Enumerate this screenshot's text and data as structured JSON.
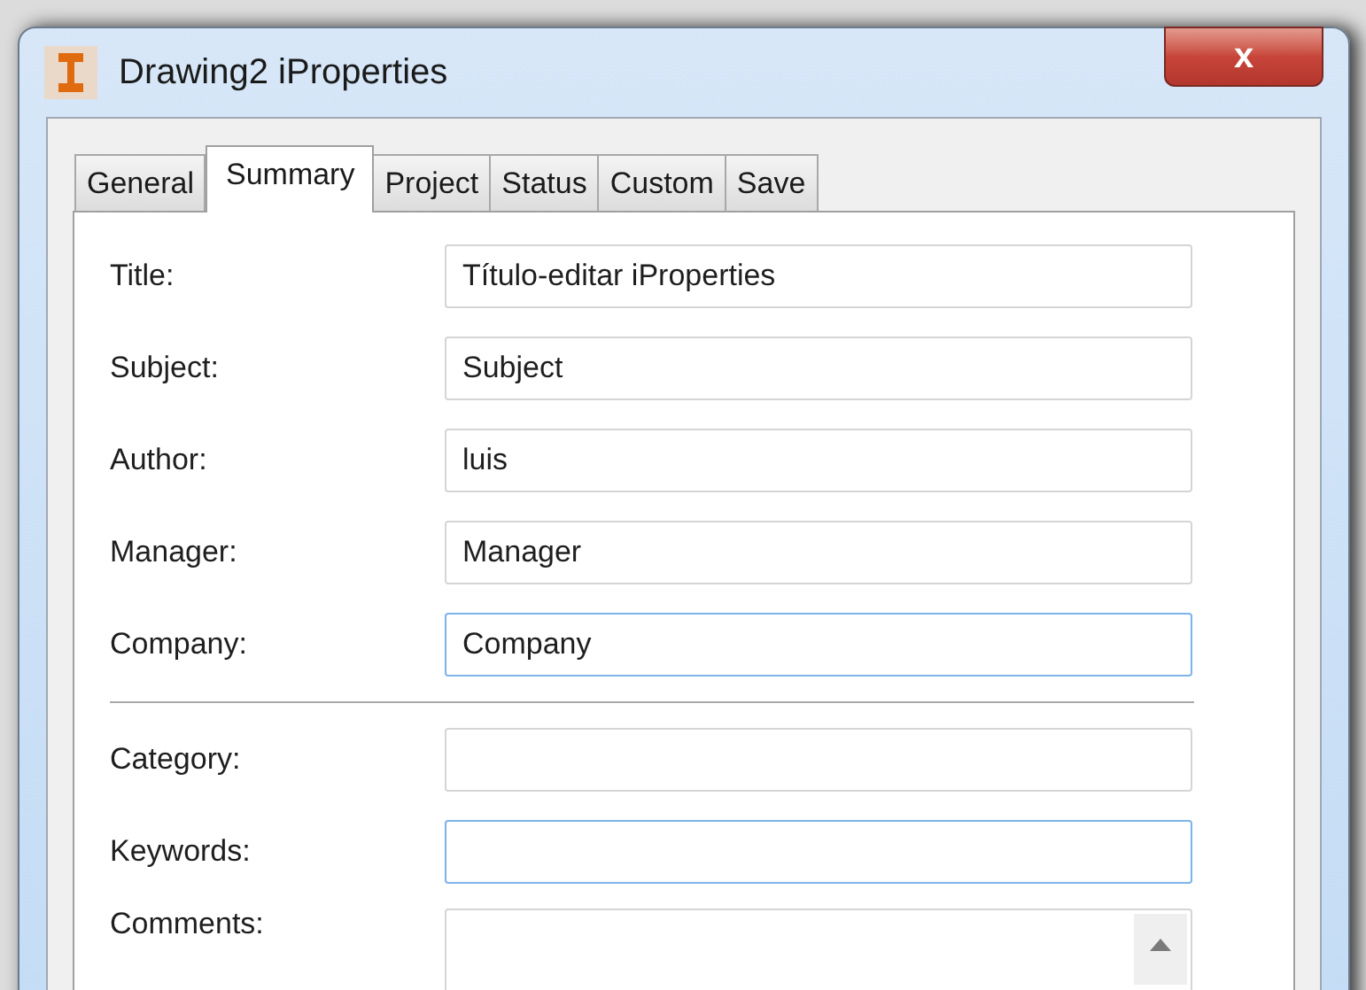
{
  "window": {
    "title": "Drawing2 iProperties",
    "close_label": "x"
  },
  "tabs": [
    {
      "label": "General",
      "selected": false
    },
    {
      "label": "Summary",
      "selected": true
    },
    {
      "label": "Project",
      "selected": false
    },
    {
      "label": "Status",
      "selected": false
    },
    {
      "label": "Custom",
      "selected": false
    },
    {
      "label": "Save",
      "selected": false
    }
  ],
  "fields": [
    {
      "label": "Title:",
      "value": "Título-editar iProperties",
      "highlighted": false,
      "kind": "text"
    },
    {
      "label": "Subject:",
      "value": "Subject",
      "highlighted": false,
      "kind": "text"
    },
    {
      "label": "Author:",
      "value": "luis",
      "highlighted": false,
      "kind": "text"
    },
    {
      "label": "Manager:",
      "value": "Manager",
      "highlighted": false,
      "kind": "text"
    },
    {
      "label": "Company:",
      "value": "Company",
      "highlighted": true,
      "kind": "text"
    },
    {
      "kind": "separator"
    },
    {
      "label": "Category:",
      "highlighted": false,
      "kind": "text"
    },
    {
      "label": "Keywords:",
      "highlighted": true,
      "kind": "text"
    },
    {
      "label": "Comments:",
      "highlighted": false,
      "kind": "textarea"
    }
  ]
}
